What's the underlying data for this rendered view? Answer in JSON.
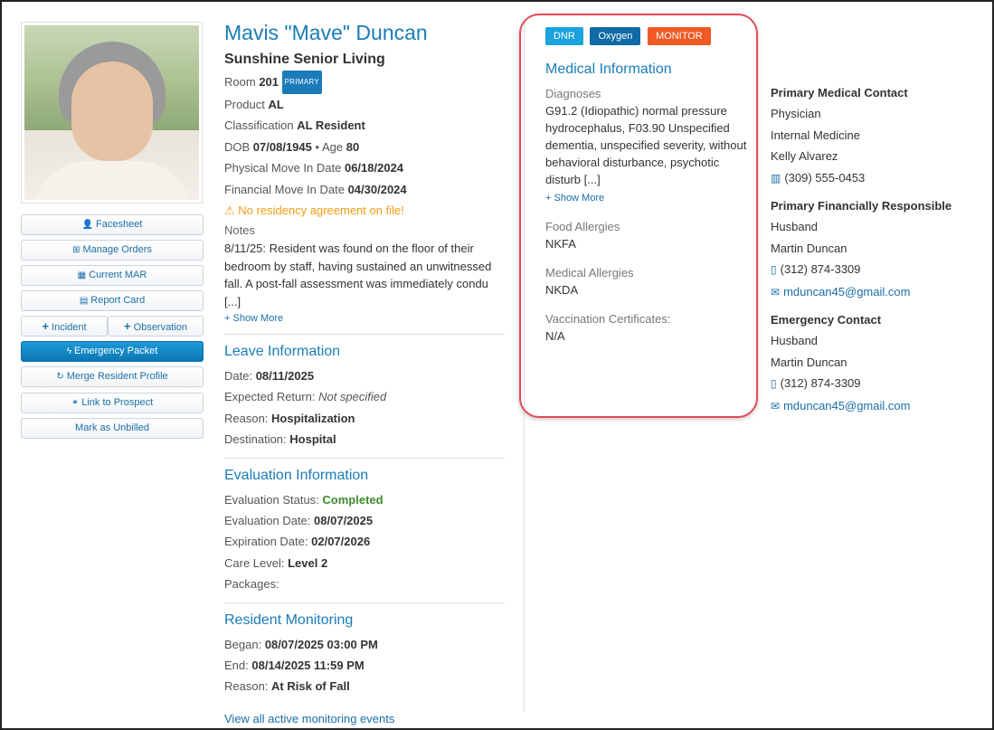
{
  "colors": {
    "accent": "#1a7cb8",
    "dnr": "#1aa3dd",
    "oxygen": "#0f6aa6",
    "monitor": "#f15a24",
    "warning": "#f39c12",
    "completed": "#3c8a2e",
    "highlight": "#e24a58"
  },
  "sidebar": {
    "buttons": [
      {
        "label": "Facesheet",
        "icon": "user-icon",
        "glyph": "👤"
      },
      {
        "label": "Manage Orders",
        "icon": "medkit-icon",
        "glyph": "⊞"
      },
      {
        "label": "Current MAR",
        "icon": "calendar-icon",
        "glyph": "▦"
      },
      {
        "label": "Report Card",
        "icon": "document-icon",
        "glyph": "▤"
      },
      {
        "label": "Incident",
        "icon": "plus-icon",
        "glyph": "+"
      },
      {
        "label": "Observation",
        "icon": "plus-icon",
        "glyph": "+"
      },
      {
        "label": "Emergency Packet",
        "icon": "bolt-icon",
        "glyph": "ϟ"
      },
      {
        "label": "Merge Resident Profile",
        "icon": "refresh-icon",
        "glyph": "↻"
      },
      {
        "label": "Link to Prospect",
        "icon": "link-icon",
        "glyph": "⚭"
      },
      {
        "label": "Mark as Unbilled",
        "icon": "",
        "glyph": ""
      }
    ]
  },
  "resident": {
    "name": "Mavis \"Mave\" Duncan",
    "facility": "Sunshine Senior Living",
    "room_label": "Room",
    "room": "201",
    "room_badge": "PRIMARY",
    "product_label": "Product",
    "product": "AL",
    "classification_label": "Classification",
    "classification": "AL Resident",
    "dob_label": "DOB",
    "dob": "07/08/1945",
    "age_sep": "•",
    "age_label": "Age",
    "age": "80",
    "physical_move_label": "Physical Move In Date",
    "physical_move": "06/18/2024",
    "financial_move_label": "Financial Move In Date",
    "financial_move": "04/30/2024",
    "warning_icon": "⚠",
    "warning": "No residency agreement on file!",
    "notes_label": "Notes",
    "notes": "8/11/25: Resident was found on the floor of their bedroom by staff, having sustained an unwitnessed fall. A post-fall assessment was immediately condu [...]",
    "show_more": "Show More"
  },
  "leave": {
    "title": "Leave Information",
    "date_label": "Date:",
    "date": "08/11/2025",
    "return_label": "Expected Return:",
    "return": "Not specified",
    "reason_label": "Reason:",
    "reason": "Hospitalization",
    "destination_label": "Destination:",
    "destination": "Hospital"
  },
  "evaluation": {
    "title": "Evaluation Information",
    "status_label": "Evaluation Status:",
    "status": "Completed",
    "date_label": "Evaluation Date:",
    "date": "08/07/2025",
    "expiration_label": "Expiration Date:",
    "expiration": "02/07/2026",
    "care_label": "Care Level:",
    "care": "Level 2",
    "packages_label": "Packages:"
  },
  "monitoring": {
    "title": "Resident Monitoring",
    "began_label": "Began:",
    "began": "08/07/2025 03:00 PM",
    "end_label": "End:",
    "end": "08/14/2025 11:59 PM",
    "reason_label": "Reason:",
    "reason": "At Risk of Fall",
    "view_all": "View all active monitoring events"
  },
  "tags": {
    "dnr": "DNR",
    "oxygen": "Oxygen",
    "monitor": "MONITOR"
  },
  "medical": {
    "title": "Medical Information",
    "diagnoses_label": "Diagnoses",
    "diagnoses": "G91.2 (Idiopathic) normal pressure hydrocephalus, F03.90 Unspecified dementia, unspecified severity, without behavioral disturbance, psychotic disturb [...]",
    "show_more": "Show More",
    "food_label": "Food Allergies",
    "food": "NKFA",
    "med_label": "Medical Allergies",
    "med": "NKDA",
    "vacc_label": "Vaccination Certificates:",
    "vacc": "N/A"
  },
  "contacts": {
    "medical": {
      "title": "Primary Medical Contact",
      "role": "Physician",
      "specialty": "Internal Medicine",
      "name": "Kelly Alvarez",
      "phone": "(309) 555-0453"
    },
    "financial": {
      "title": "Primary Financially Responsible",
      "relation": "Husband",
      "name": "Martin Duncan",
      "phone": "(312) 874-3309",
      "email": "mduncan45@gmail.com"
    },
    "emergency": {
      "title": "Emergency Contact",
      "relation": "Husband",
      "name": "Martin Duncan",
      "phone": "(312) 874-3309",
      "email": "mduncan45@gmail.com"
    }
  }
}
